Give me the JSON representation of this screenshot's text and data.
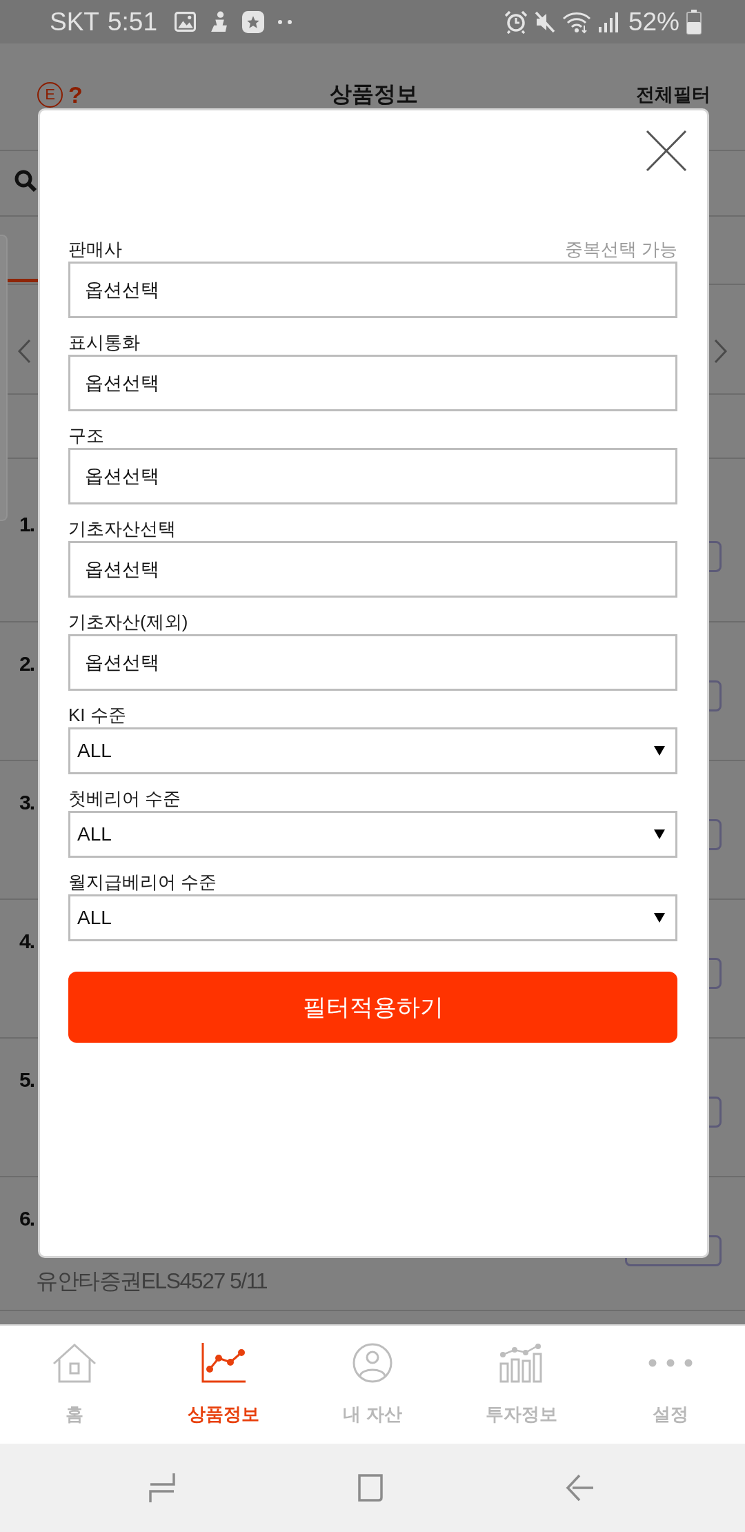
{
  "status_bar": {
    "carrier": "SKT",
    "time": "5:51",
    "battery": "52%"
  },
  "header": {
    "logo": "E",
    "help": "?",
    "title": "상품정보",
    "action": "전체필터"
  },
  "list": {
    "rows": [
      {
        "number": "1."
      },
      {
        "number": "2."
      },
      {
        "number": "3."
      },
      {
        "number": "4."
      },
      {
        "number": "5."
      },
      {
        "number": "6.",
        "caption": "유안타증권ELS4527 5/11"
      }
    ]
  },
  "filter_dialog": {
    "fields": [
      {
        "kind": "picker",
        "label": "판매사",
        "hint": "중복선택 가능",
        "value": "옵션선택"
      },
      {
        "kind": "picker",
        "label": "표시통화",
        "value": "옵션선택"
      },
      {
        "kind": "picker",
        "label": "구조",
        "value": "옵션선택"
      },
      {
        "kind": "picker",
        "label": "기초자산선택",
        "value": "옵션선택"
      },
      {
        "kind": "picker",
        "label": "기초자산(제외)",
        "value": "옵션선택"
      },
      {
        "kind": "dropdown",
        "label": "KI 수준",
        "value": "ALL"
      },
      {
        "kind": "dropdown",
        "label": "첫베리어 수준",
        "value": "ALL"
      },
      {
        "kind": "dropdown",
        "label": "월지급베리어 수준",
        "value": "ALL"
      }
    ],
    "apply_button": "필터적용하기"
  },
  "bottom_nav": [
    {
      "label": "홈",
      "selected": false
    },
    {
      "label": "상품정보",
      "selected": true
    },
    {
      "label": "내 자산",
      "selected": false
    },
    {
      "label": "투자정보",
      "selected": false
    },
    {
      "label": "설정",
      "selected": false
    }
  ]
}
